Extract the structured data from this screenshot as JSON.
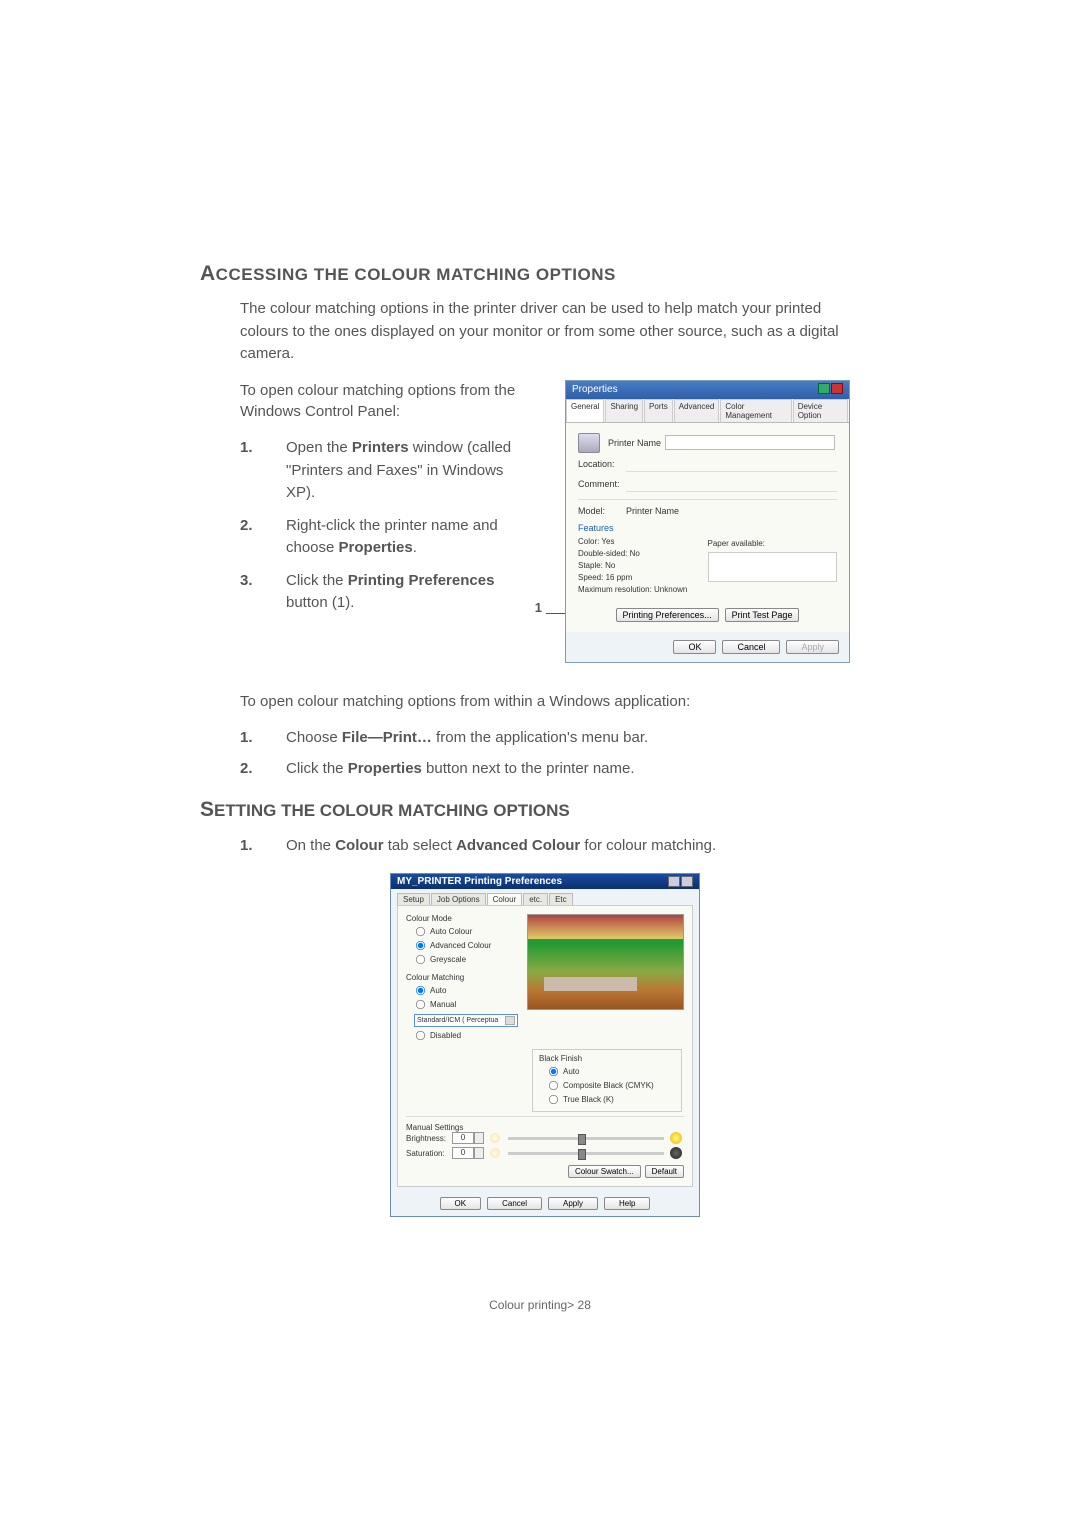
{
  "section1": {
    "heading_cap": "A",
    "heading_rest": "CCESSING THE COLOUR MATCHING OPTIONS",
    "intro": "The colour matching options in the printer driver can be used to help match your printed colours to the ones displayed on your monitor or from some other source, such as a digital camera.",
    "intro2": "To open colour matching options from the Windows Control Panel:",
    "steps": [
      {
        "num": "1.",
        "pre": "Open the ",
        "bold": "Printers",
        "post": " window (called \"Printers and Faxes\" in Windows XP)."
      },
      {
        "num": "2.",
        "pre": "Right-click the printer name and choose ",
        "bold": "Properties",
        "post": "."
      },
      {
        "num": "3.",
        "pre": "Click the ",
        "bold": "Printing Preferences",
        "post": " button (1)."
      }
    ],
    "callout_one": "1"
  },
  "dlg1": {
    "title": "Properties",
    "tabs": [
      "General",
      "Sharing",
      "Ports",
      "Advanced",
      "Color Management",
      "Device Option"
    ],
    "printer_name_label": "Printer Name",
    "location": "Location:",
    "comment": "Comment:",
    "model": "Model:",
    "model_value": "Printer Name",
    "features": "Features",
    "feat_left": [
      "Color: Yes",
      "Double-sided: No",
      "Staple: No",
      "Speed: 16 ppm",
      "Maximum resolution: Unknown"
    ],
    "feat_right_label": "Paper available:",
    "btns": {
      "pref": "Printing Preferences...",
      "test": "Print Test Page"
    },
    "footer": {
      "ok": "OK",
      "cancel": "Cancel",
      "apply": "Apply"
    }
  },
  "section2": {
    "intro": "To open colour matching options from within a Windows application:",
    "steps": [
      {
        "num": "1.",
        "pre": "Choose ",
        "bold": "File—Print…",
        "post": " from the application's menu bar."
      },
      {
        "num": "2.",
        "pre": "Click the ",
        "bold": "Properties",
        "post": " button next to the printer name."
      }
    ]
  },
  "section3": {
    "heading_cap": "S",
    "heading_rest": "ETTING THE COLOUR MATCHING OPTIONS",
    "steps": [
      {
        "num": "1.",
        "pre": "On the ",
        "bold1": "Colour",
        "mid": " tab select ",
        "bold2": "Advanced Colour",
        "post": " for colour matching."
      }
    ]
  },
  "dlg2": {
    "title": "MY_PRINTER Printing Preferences",
    "tabs": [
      "Setup",
      "Job Options",
      "Colour",
      "etc.",
      "Etc"
    ],
    "colour_mode": {
      "title": "Colour Mode",
      "opts": [
        "Auto Colour",
        "Advanced Colour",
        "Greyscale"
      ]
    },
    "colour_matching": {
      "title": "Colour Matching",
      "opts": [
        "Auto",
        "Manual"
      ],
      "combo": "Standard/ICM ( Perceptua",
      "disabled": "Disabled"
    },
    "black_finish": {
      "title": "Black Finish",
      "opts": [
        "Auto",
        "Composite Black (CMYK)",
        "True Black (K)"
      ]
    },
    "manual": {
      "title": "Manual Settings",
      "brightness": "Brightness:",
      "saturation": "Saturation:",
      "val": "0"
    },
    "btns": {
      "swatch": "Colour Swatch...",
      "default": "Default"
    },
    "footer": {
      "ok": "OK",
      "cancel": "Cancel",
      "apply": "Apply",
      "help": "Help"
    }
  },
  "footer": {
    "title": "Colour printing",
    "page": "28"
  }
}
